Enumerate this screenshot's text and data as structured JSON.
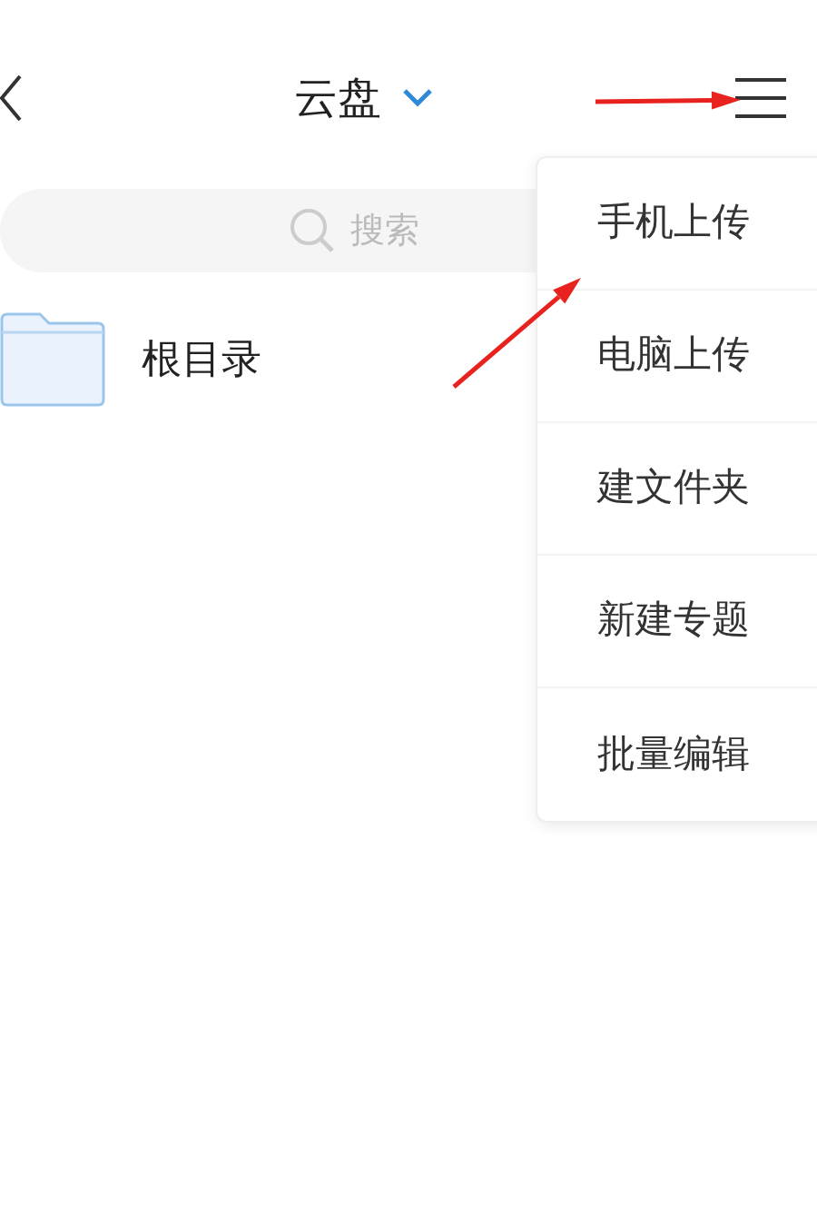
{
  "header": {
    "title": "云盘"
  },
  "search": {
    "placeholder": "搜索"
  },
  "folders": [
    {
      "name": "根目录"
    }
  ],
  "menu": {
    "items": [
      {
        "label": "手机上传"
      },
      {
        "label": "电脑上传"
      },
      {
        "label": "建文件夹"
      },
      {
        "label": "新建专题"
      },
      {
        "label": "批量编辑"
      }
    ]
  }
}
